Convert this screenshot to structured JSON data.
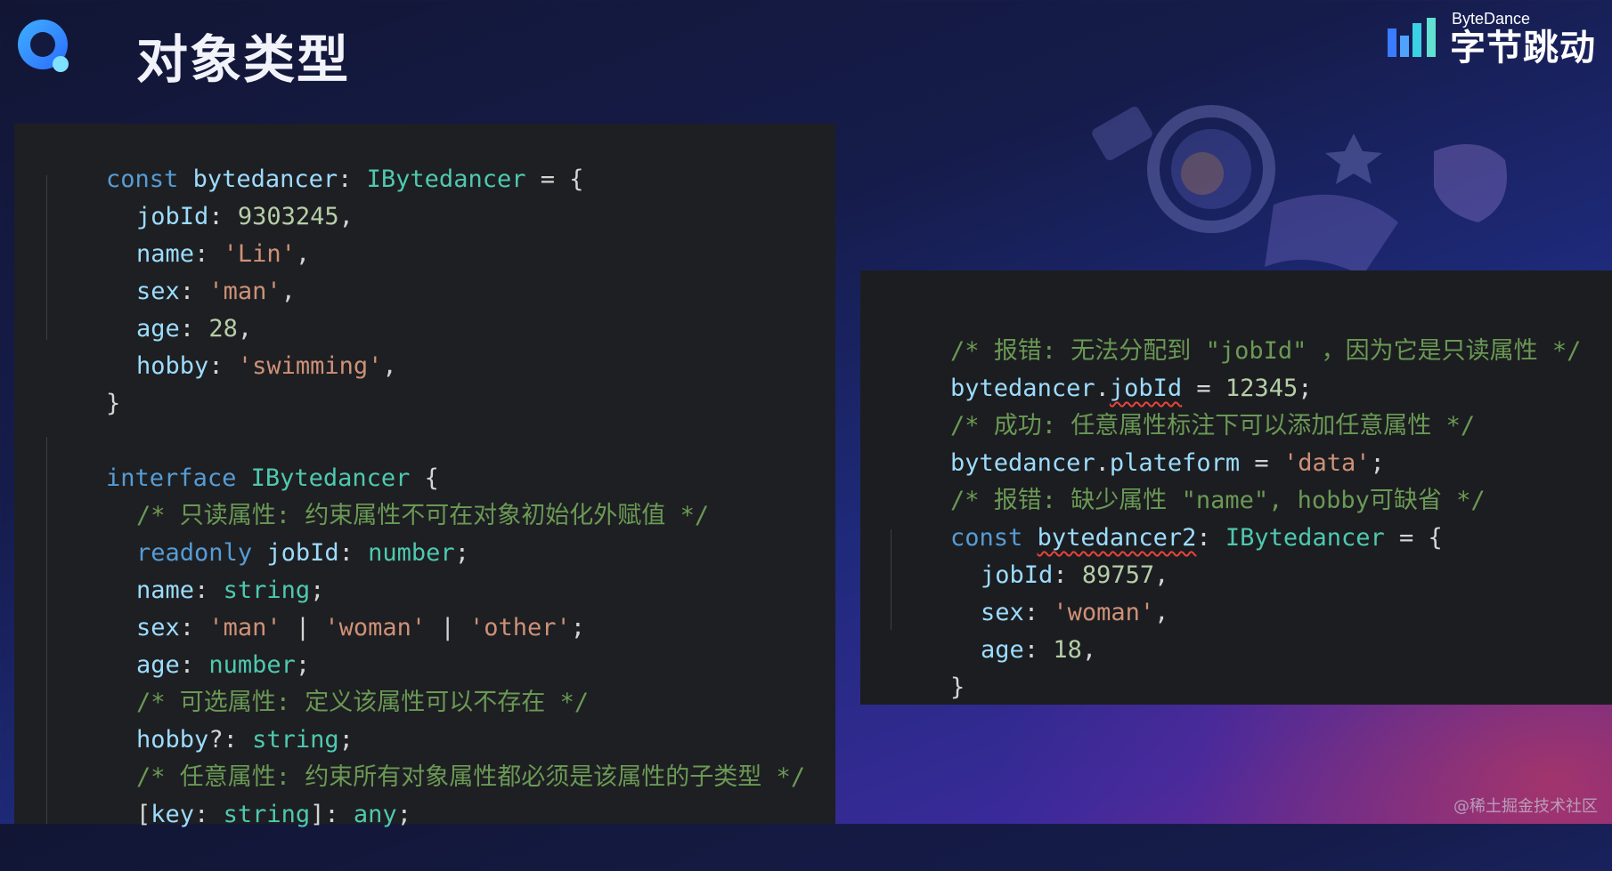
{
  "header": {
    "title": "对象类型"
  },
  "brand": {
    "en": "ByteDance",
    "cn": "字节跳动"
  },
  "watermark": "@稀土掘金技术社区",
  "colors": {
    "accent": "#1e90ff",
    "panel_bg": "#1e1f22"
  },
  "left_code": {
    "l1": {
      "kw": "const",
      "name": "bytedancer",
      "sep": ": ",
      "type": "IBytedancer",
      "rest": " = {"
    },
    "l2": {
      "prop": "jobId",
      "sep": ": ",
      "val": "9303245",
      "end": ","
    },
    "l3": {
      "prop": "name",
      "sep": ": ",
      "val": "'Lin'",
      "end": ","
    },
    "l4": {
      "prop": "sex",
      "sep": ": ",
      "val": "'man'",
      "end": ","
    },
    "l5": {
      "prop": "age",
      "sep": ": ",
      "val": "28",
      "end": ","
    },
    "l6": {
      "prop": "hobby",
      "sep": ": ",
      "val": "'swimming'",
      "end": ","
    },
    "l7": {
      "text": "}"
    },
    "l8": {
      "kw": "interface",
      "type": "IBytedancer",
      "rest": " {"
    },
    "l9": {
      "comment": "/* 只读属性: 约束属性不可在对象初始化外赋值 */"
    },
    "l10": {
      "kw": "readonly",
      "prop": "jobId",
      "sep": ": ",
      "type": "number",
      "end": ";"
    },
    "l11": {
      "prop": "name",
      "sep": ": ",
      "type": "string",
      "end": ";"
    },
    "l12": {
      "prop": "sex",
      "sep": ": ",
      "s1": "'man'",
      "bar1": " | ",
      "s2": "'woman'",
      "bar2": " | ",
      "s3": "'other'",
      "end": ";"
    },
    "l13": {
      "prop": "age",
      "sep": ": ",
      "type": "number",
      "end": ";"
    },
    "l14": {
      "comment": "/* 可选属性: 定义该属性可以不存在 */"
    },
    "l15": {
      "prop": "hobby",
      "sep": "?: ",
      "type": "string",
      "end": ";"
    },
    "l16": {
      "comment": "/* 任意属性: 约束所有对象属性都必须是该属性的子类型 */"
    },
    "l17": {
      "open": "[",
      "prop": "key",
      "sep": ": ",
      "type": "string",
      "close": "]: ",
      "type2": "any",
      "end": ";"
    }
  },
  "right_code": {
    "r1": {
      "comment": "/* 报错: 无法分配到 \"jobId\" ，因为它是只读属性 */"
    },
    "r2": {
      "obj": "bytedancer",
      "dot": ".",
      "prop": "jobId",
      "eq": " = ",
      "val": "12345",
      "end": ";"
    },
    "r3": {
      "comment": "/* 成功: 任意属性标注下可以添加任意属性 */"
    },
    "r4": {
      "obj": "bytedancer",
      "dot": ".",
      "prop": "plateform",
      "eq": " = ",
      "val": "'data'",
      "end": ";"
    },
    "r5": {
      "comment": "/* 报错: 缺少属性 \"name\", hobby可缺省 */"
    },
    "r6": {
      "kw": "const",
      "name": "bytedancer2",
      "sep": ": ",
      "type": "IBytedancer",
      "rest": " = {"
    },
    "r7": {
      "prop": "jobId",
      "sep": ": ",
      "val": "89757",
      "end": ","
    },
    "r8": {
      "prop": "sex",
      "sep": ": ",
      "val": "'woman'",
      "end": ","
    },
    "r9": {
      "prop": "age",
      "sep": ": ",
      "val": "18",
      "end": ","
    },
    "r10": {
      "text": "}"
    }
  }
}
